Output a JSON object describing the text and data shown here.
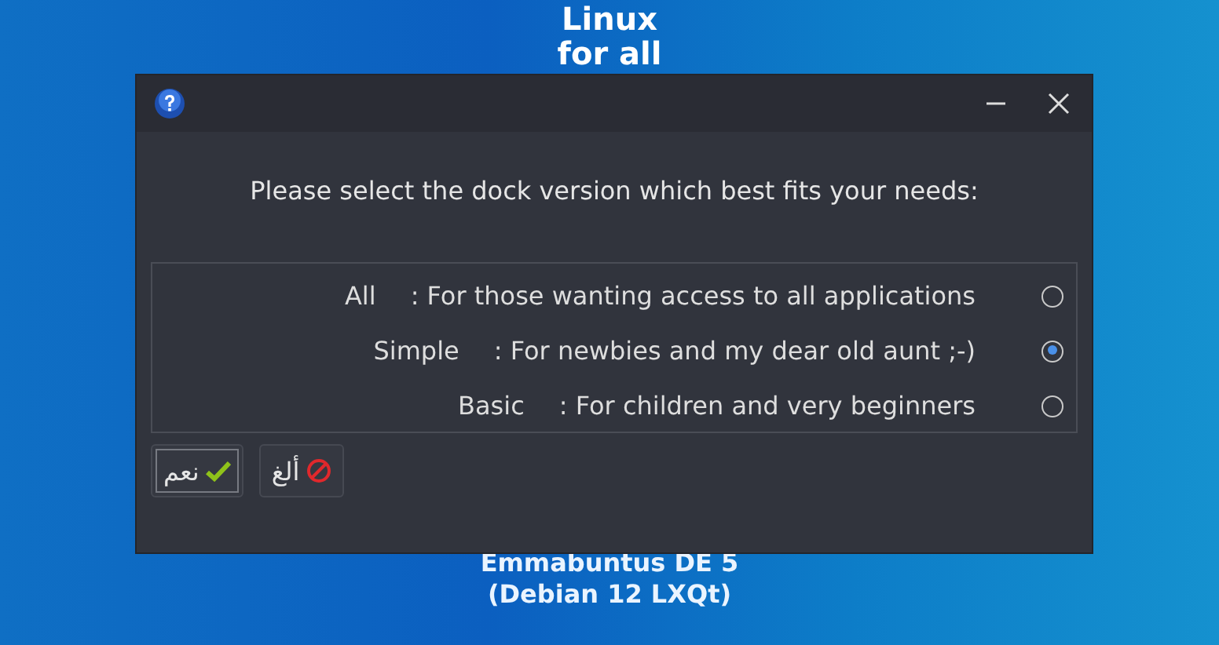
{
  "desktop": {
    "top_lines": [
      "Linux",
      "for all"
    ],
    "bottom_lines": [
      "Emmabuntus DE 5",
      "(Debian 12 LXQt)"
    ]
  },
  "dialog": {
    "prompt": "Please select the dock version which best fits your needs:",
    "options": [
      {
        "label": "All",
        "description": ": For those wanting access to all applications",
        "selected": false
      },
      {
        "label": "Simple",
        "description": ": For newbies and my dear old aunt ;-)",
        "selected": true
      },
      {
        "label": "Basic",
        "description": ": For children and very beginners",
        "selected": false
      }
    ],
    "buttons": [
      {
        "kind": "cancel",
        "label": "ألغ",
        "default": false
      },
      {
        "kind": "ok",
        "label": "نعم",
        "default": true
      }
    ]
  }
}
